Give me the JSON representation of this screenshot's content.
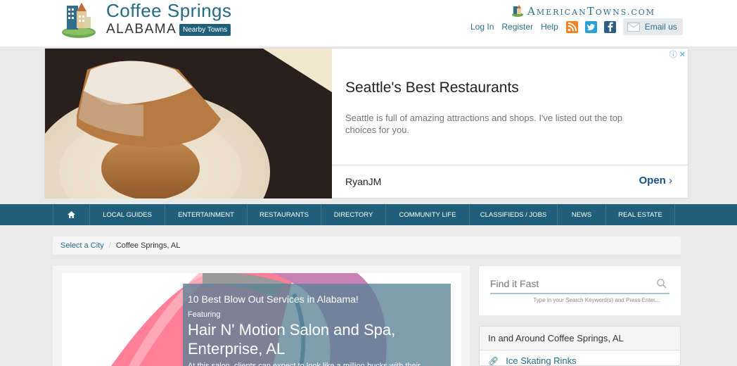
{
  "header": {
    "site_title": "Coffee Springs",
    "state": "ALABAMA",
    "nearby_label": "Nearby Towns",
    "brand_name_big_1": "A",
    "brand_name_small_1": "MERICAN",
    "brand_name_big_2": "T",
    "brand_name_small_2": "OWNS.COM",
    "links": {
      "login": "Log In",
      "register": "Register",
      "help": "Help"
    },
    "social": {
      "rss": "rss-icon",
      "twitter": "twitter-icon",
      "facebook": "facebook-icon"
    },
    "email_label": "Email us"
  },
  "ad": {
    "title": "Seattle's Best Restaurants",
    "description": "Seattle is full of amazing attractions and shops. I've listed out the top choices for you.",
    "advertiser": "RyanJM",
    "cta": "Open",
    "info_glyph": "ⓘ",
    "close_glyph": "✕"
  },
  "nav": {
    "home_glyph": "⌂",
    "items": [
      {
        "label": "LOCAL GUIDES"
      },
      {
        "label": "ENTERTAINMENT"
      },
      {
        "label": "RESTAURANTS"
      },
      {
        "label": "DIRECTORY"
      },
      {
        "label": "COMMUNITY LIFE"
      },
      {
        "label": "CLASSIFIEDS / JOBS"
      },
      {
        "label": "NEWS"
      },
      {
        "label": "REAL ESTATE"
      }
    ]
  },
  "breadcrumb": {
    "root": "Select a City",
    "separator": "/",
    "current": "Coffee Springs, AL"
  },
  "feature": {
    "kicker": "10 Best Blow Out Services in Alabama!",
    "label": "Featuring",
    "title": "Hair N' Motion Salon and Spa, Enterprise, AL",
    "snippet": "At this salon, clients can expect to look like a million bucks with their"
  },
  "search": {
    "placeholder": "Find it Fast",
    "hint": "Type in your Search Keyword(s) and Press Enter..."
  },
  "around": {
    "heading": "In and Around Coffee Springs, AL",
    "items": [
      {
        "label": "Ice Skating Rinks"
      }
    ]
  },
  "colors": {
    "brand_teal": "#1f5f7a",
    "link": "#246a83",
    "rss": "#f58220",
    "twitter": "#2a9fd8",
    "facebook": "#2b5f87"
  }
}
